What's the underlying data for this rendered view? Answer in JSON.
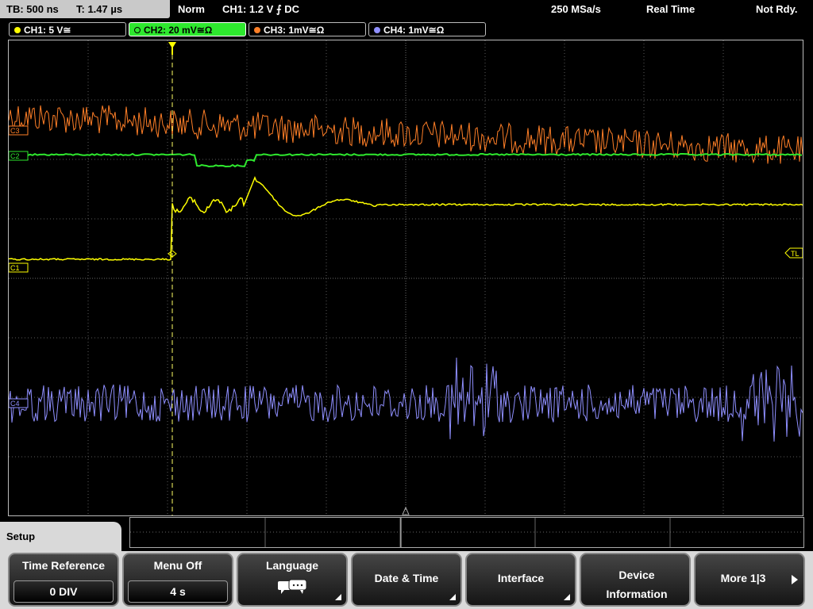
{
  "status_bar": {
    "timebase": "TB: 500 ns",
    "trigger_time": "T: 1.47 µs",
    "trigger_mode": "Norm",
    "trigger_source": "CH1: 1.2 V ⨍ DC",
    "sample_rate": "250 MSa/s",
    "acq_mode": "Real Time",
    "state": "Not Rdy."
  },
  "channels": [
    {
      "label": "CH1: 5 V≅",
      "color": "#ffff00",
      "marker": "C1"
    },
    {
      "label": "CH2: 20 mV≅Ω",
      "color": "#2ee82e",
      "marker": "C2"
    },
    {
      "label": "CH3: 1mV≅Ω",
      "color": "#ff7f27",
      "marker": "C3"
    },
    {
      "label": "CH4: 1mV≅Ω",
      "color": "#8f8fff",
      "marker": "C4"
    }
  ],
  "markers": {
    "trigger_level": "TL"
  },
  "colors": {
    "grid": "#5a5a5a",
    "panel": "#d9d9d9"
  },
  "setup_menu": {
    "title": "Setup",
    "softkeys": [
      {
        "title": "Time Reference",
        "value": "0 DIV"
      },
      {
        "title": "Menu Off",
        "value": "4 s"
      },
      {
        "title": "Language",
        "icon": "speech-bubbles-icon"
      },
      {
        "title": "Date & Time"
      },
      {
        "title": "Interface"
      },
      {
        "title": "Device Information"
      },
      {
        "title": "More 1|3",
        "icon": "play-arrow-icon"
      }
    ]
  }
}
